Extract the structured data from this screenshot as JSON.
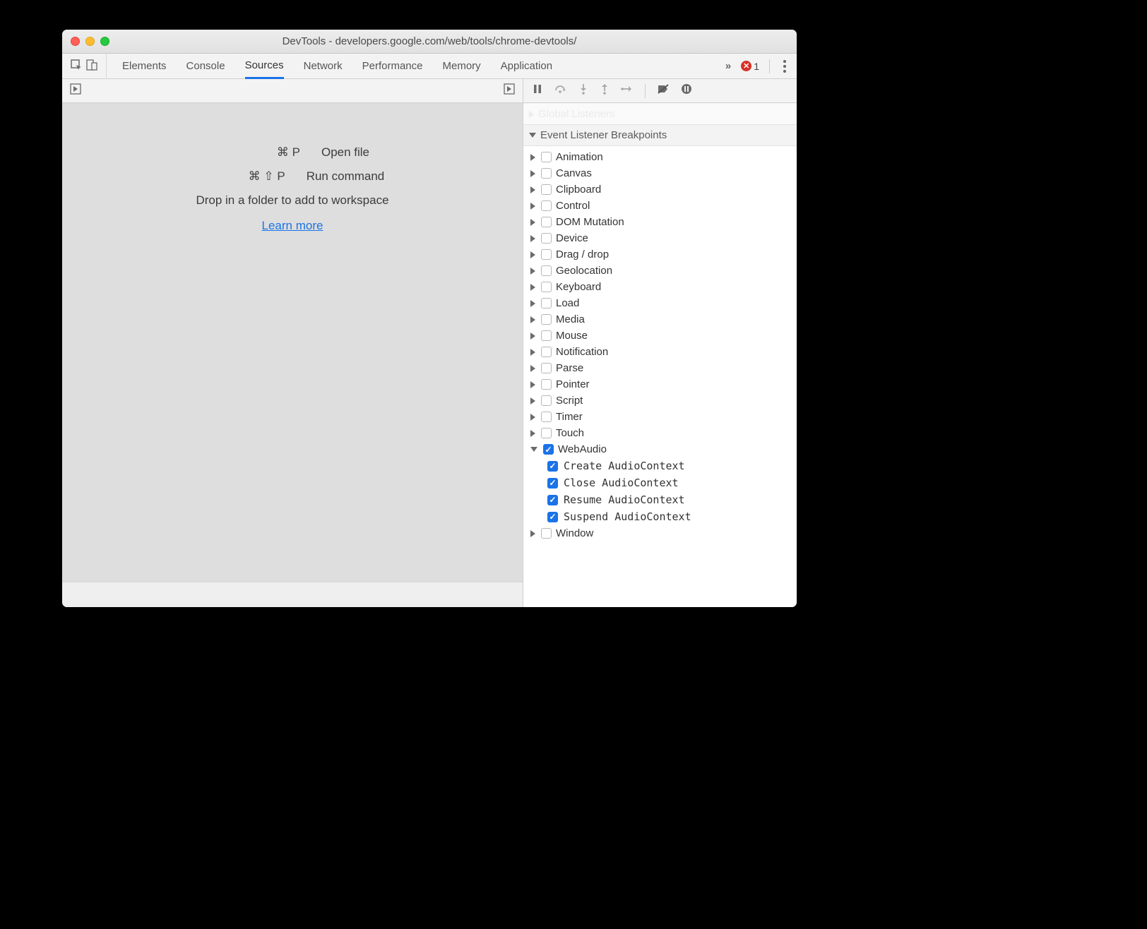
{
  "window": {
    "title": "DevTools - developers.google.com/web/tools/chrome-devtools/"
  },
  "tabs": {
    "elements": "Elements",
    "console": "Console",
    "sources": "Sources",
    "network": "Network",
    "performance": "Performance",
    "memory": "Memory",
    "application": "Application",
    "active": "sources"
  },
  "errors": {
    "count": "1"
  },
  "empty": {
    "openfile_keys": "⌘ P",
    "openfile_label": "Open file",
    "runcmd_keys": "⌘ ⇧ P",
    "runcmd_label": "Run command",
    "drop_hint": "Drop in a folder to add to workspace",
    "learn_more": "Learn more"
  },
  "sidebar": {
    "global_listeners": "Global Listeners",
    "event_breakpoints": "Event Listener Breakpoints",
    "categories": [
      {
        "label": "Animation",
        "checked": false,
        "expanded": false
      },
      {
        "label": "Canvas",
        "checked": false,
        "expanded": false
      },
      {
        "label": "Clipboard",
        "checked": false,
        "expanded": false
      },
      {
        "label": "Control",
        "checked": false,
        "expanded": false
      },
      {
        "label": "DOM Mutation",
        "checked": false,
        "expanded": false
      },
      {
        "label": "Device",
        "checked": false,
        "expanded": false
      },
      {
        "label": "Drag / drop",
        "checked": false,
        "expanded": false
      },
      {
        "label": "Geolocation",
        "checked": false,
        "expanded": false
      },
      {
        "label": "Keyboard",
        "checked": false,
        "expanded": false
      },
      {
        "label": "Load",
        "checked": false,
        "expanded": false
      },
      {
        "label": "Media",
        "checked": false,
        "expanded": false
      },
      {
        "label": "Mouse",
        "checked": false,
        "expanded": false
      },
      {
        "label": "Notification",
        "checked": false,
        "expanded": false
      },
      {
        "label": "Parse",
        "checked": false,
        "expanded": false
      },
      {
        "label": "Pointer",
        "checked": false,
        "expanded": false
      },
      {
        "label": "Script",
        "checked": false,
        "expanded": false
      },
      {
        "label": "Timer",
        "checked": false,
        "expanded": false
      },
      {
        "label": "Touch",
        "checked": false,
        "expanded": false
      },
      {
        "label": "WebAudio",
        "checked": true,
        "expanded": true,
        "children": [
          {
            "label": "Create AudioContext",
            "checked": true
          },
          {
            "label": "Close AudioContext",
            "checked": true
          },
          {
            "label": "Resume AudioContext",
            "checked": true
          },
          {
            "label": "Suspend AudioContext",
            "checked": true
          }
        ]
      },
      {
        "label": "Window",
        "checked": false,
        "expanded": false
      }
    ]
  }
}
